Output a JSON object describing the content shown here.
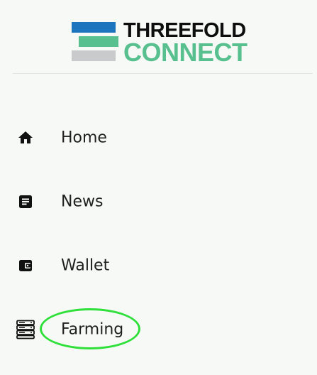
{
  "logo": {
    "line1": "THREEFOLD",
    "line2": "CONNECT",
    "colors": {
      "blue": "#1d74be",
      "green": "#57c08e",
      "gray": "#c9cacb",
      "text": "#0e0e0e"
    }
  },
  "nav": {
    "items": [
      {
        "label": "Home",
        "icon": "home-icon"
      },
      {
        "label": "News",
        "icon": "news-icon"
      },
      {
        "label": "Wallet",
        "icon": "wallet-icon"
      },
      {
        "label": "Farming",
        "icon": "farming-icon"
      }
    ]
  },
  "highlight": {
    "target": "Farming",
    "color": "#2fe03a"
  }
}
